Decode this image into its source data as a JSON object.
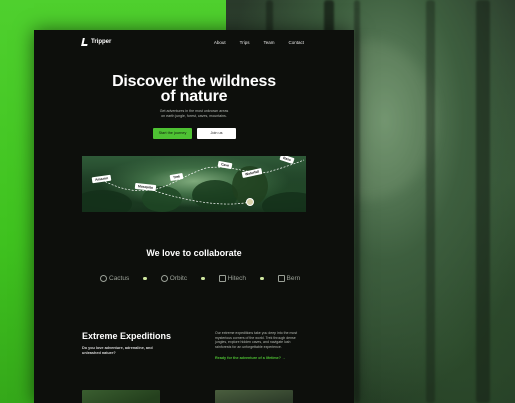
{
  "site": {
    "logo": "Tripper",
    "nav": [
      "About",
      "Trips",
      "Team",
      "Contact"
    ]
  },
  "hero": {
    "title_line1": "Discover the wildness",
    "title_line2": "of nature",
    "subtitle_line1": "Get adventures in the most unknown areas",
    "subtitle_line2": "on earth jungle, forest, caves, mountains.",
    "primary_button": "Start the journey",
    "secondary_button": "Join us"
  },
  "map_tags": [
    "Amazon",
    "Mosquito",
    "Trek",
    "Cave",
    "Waterfall",
    "Base"
  ],
  "collab": {
    "title": "We love to collaborate",
    "partners": [
      "Cactus",
      "Orbitc",
      "Hitech",
      "Bern"
    ]
  },
  "expeditions": {
    "title": "Extreme Expeditions",
    "subtitle": "Do you love adventure, adrenaline, and unleashed nature?",
    "description": "Our extreme expeditions take you deep into the most mysterious corners of the world. Trek through dense jungles, explore hidden caves, and navigate lush rainforests for an unforgettable experience.",
    "link": "Ready for the adventure of a lifetime?  →"
  },
  "colors": {
    "accent": "#4ec233",
    "page_bg": "#0d0f0c",
    "side_green": "#3fc21f"
  }
}
